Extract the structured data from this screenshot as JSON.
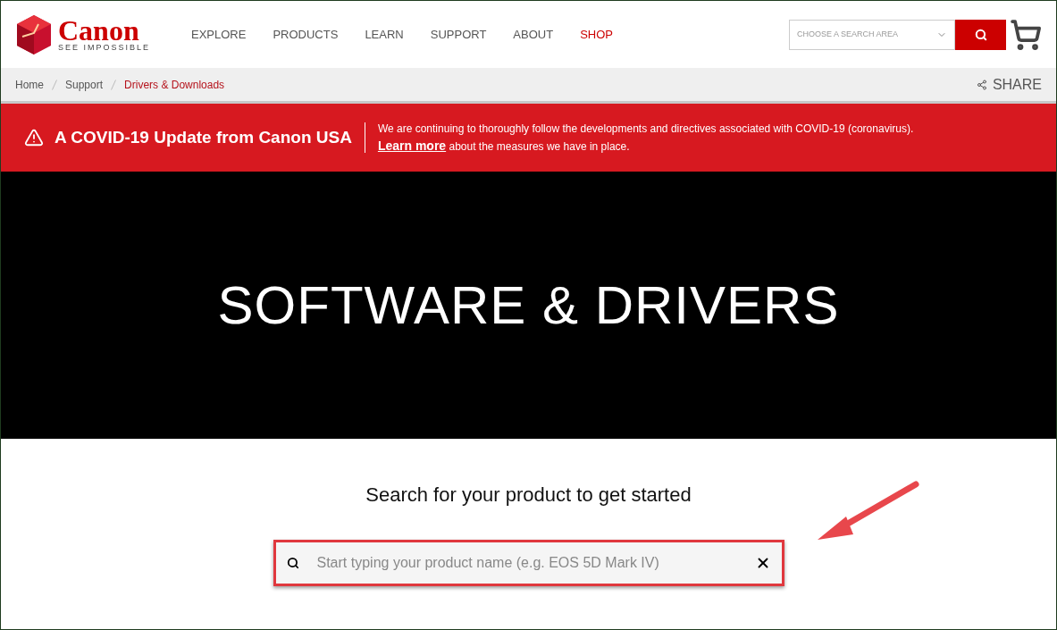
{
  "logo": {
    "wordmark": "Canon",
    "tagline": "SEE IMPOSSIBLE"
  },
  "nav": [
    {
      "label": "EXPLORE",
      "color": "#555555"
    },
    {
      "label": "PRODUCTS",
      "color": "#555555"
    },
    {
      "label": "LEARN",
      "color": "#555555"
    },
    {
      "label": "SUPPORT",
      "color": "#555555"
    },
    {
      "label": "ABOUT",
      "color": "#555555"
    },
    {
      "label": "SHOP",
      "color": "#cc0000"
    }
  ],
  "search_area": {
    "placeholder": "CHOOSE A SEARCH AREA"
  },
  "breadcrumbs": [
    {
      "label": "Home",
      "current": false
    },
    {
      "label": "Support",
      "current": false
    },
    {
      "label": "Drivers & Downloads",
      "current": true
    }
  ],
  "share": "SHARE",
  "alert": {
    "title": "A COVID-19 Update from Canon USA",
    "message": "We are continuing to thoroughly follow the developments and directives associated with COVID-19 (coronavirus).",
    "link": "Learn more",
    "message_end": "about the measures we have in place."
  },
  "hero": {
    "title": "SOFTWARE & DRIVERS"
  },
  "product_search": {
    "heading": "Search for your product to get started",
    "placeholder": "Start typing your product name (e.g. EOS 5D Mark IV)"
  }
}
